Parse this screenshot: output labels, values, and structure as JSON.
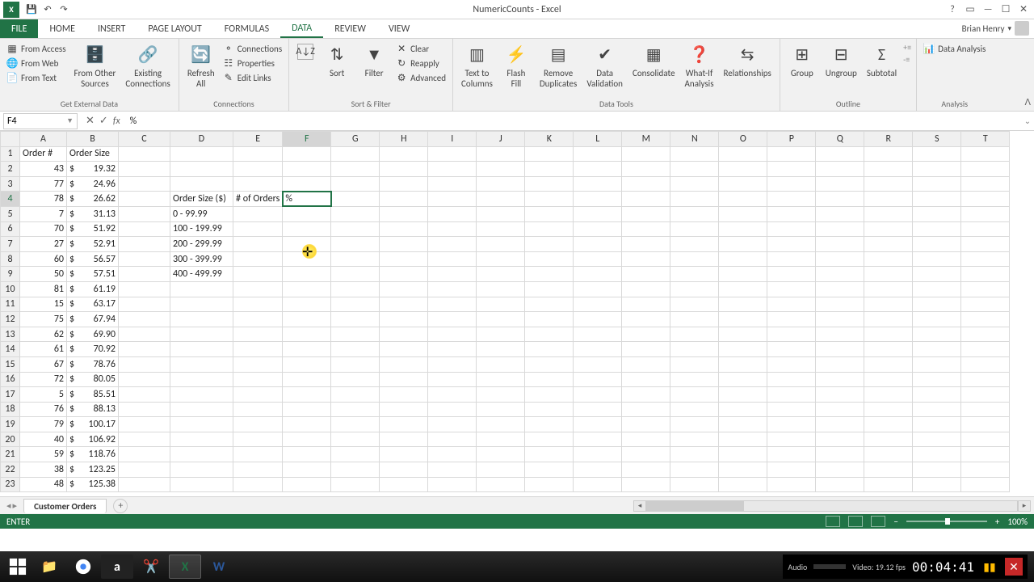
{
  "window": {
    "title": "NumericCounts - Excel",
    "user": "Brian Henry"
  },
  "qat": {
    "save": "💾",
    "undo": "↶",
    "redo": "↷"
  },
  "tabs": {
    "file": "FILE",
    "home": "HOME",
    "insert": "INSERT",
    "page_layout": "PAGE LAYOUT",
    "formulas": "FORMULAS",
    "data": "DATA",
    "review": "REVIEW",
    "view": "VIEW"
  },
  "ribbon": {
    "get_external": {
      "label": "Get External Data",
      "from_access": "From Access",
      "from_web": "From Web",
      "from_text": "From Text",
      "other_sources": "From Other\nSources",
      "existing": "Existing\nConnections"
    },
    "connections": {
      "label": "Connections",
      "refresh": "Refresh\nAll",
      "connections": "Connections",
      "properties": "Properties",
      "edit_links": "Edit Links"
    },
    "sort_filter": {
      "label": "Sort & Filter",
      "sort": "Sort",
      "filter": "Filter",
      "clear": "Clear",
      "reapply": "Reapply",
      "advanced": "Advanced"
    },
    "data_tools": {
      "label": "Data Tools",
      "text_to_cols": "Text to\nColumns",
      "flash_fill": "Flash\nFill",
      "remove_dup": "Remove\nDuplicates",
      "validation": "Data\nValidation",
      "consolidate": "Consolidate",
      "what_if": "What-If\nAnalysis",
      "relationships": "Relationships"
    },
    "outline": {
      "label": "Outline",
      "group": "Group",
      "ungroup": "Ungroup",
      "subtotal": "Subtotal"
    },
    "analysis": {
      "label": "Analysis",
      "data_analysis": "Data Analysis"
    }
  },
  "formula": {
    "name_box": "F4",
    "value": "%"
  },
  "columns": [
    "A",
    "B",
    "C",
    "D",
    "E",
    "F",
    "G",
    "H",
    "I",
    "J",
    "K",
    "L",
    "M",
    "N",
    "O",
    "P",
    "Q",
    "R",
    "S",
    "T"
  ],
  "headers": {
    "A": "Order #",
    "B": "Order Size"
  },
  "side_table": {
    "D4": "Order Size ($)",
    "E4": "# of Orders",
    "F4": "%",
    "D5": "0 - 99.99",
    "D6": "100 - 199.99",
    "D7": "200 - 299.99",
    "D8": "300 - 399.99",
    "D9": "400 - 499.99"
  },
  "rows": [
    {
      "n": 1
    },
    {
      "n": 2,
      "A": "43",
      "B": "19.32"
    },
    {
      "n": 3,
      "A": "77",
      "B": "24.96"
    },
    {
      "n": 4,
      "A": "78",
      "B": "26.62"
    },
    {
      "n": 5,
      "A": "7",
      "B": "31.13"
    },
    {
      "n": 6,
      "A": "70",
      "B": "51.92"
    },
    {
      "n": 7,
      "A": "27",
      "B": "52.91"
    },
    {
      "n": 8,
      "A": "60",
      "B": "56.57"
    },
    {
      "n": 9,
      "A": "50",
      "B": "57.51"
    },
    {
      "n": 10,
      "A": "81",
      "B": "61.19"
    },
    {
      "n": 11,
      "A": "15",
      "B": "63.17"
    },
    {
      "n": 12,
      "A": "75",
      "B": "67.94"
    },
    {
      "n": 13,
      "A": "62",
      "B": "69.90"
    },
    {
      "n": 14,
      "A": "61",
      "B": "70.92"
    },
    {
      "n": 15,
      "A": "67",
      "B": "78.76"
    },
    {
      "n": 16,
      "A": "72",
      "B": "80.05"
    },
    {
      "n": 17,
      "A": "5",
      "B": "85.51"
    },
    {
      "n": 18,
      "A": "76",
      "B": "88.13"
    },
    {
      "n": 19,
      "A": "79",
      "B": "100.17"
    },
    {
      "n": 20,
      "A": "40",
      "B": "106.92"
    },
    {
      "n": 21,
      "A": "59",
      "B": "118.76"
    },
    {
      "n": 22,
      "A": "38",
      "B": "123.25"
    },
    {
      "n": 23,
      "A": "48",
      "B": "125.38"
    }
  ],
  "sheet": {
    "name": "Customer Orders"
  },
  "status": {
    "mode": "ENTER",
    "zoom": "100%"
  },
  "recorder": {
    "audio": "Audio",
    "video": "Video: 19.12 fps",
    "time": "00:04:41"
  }
}
